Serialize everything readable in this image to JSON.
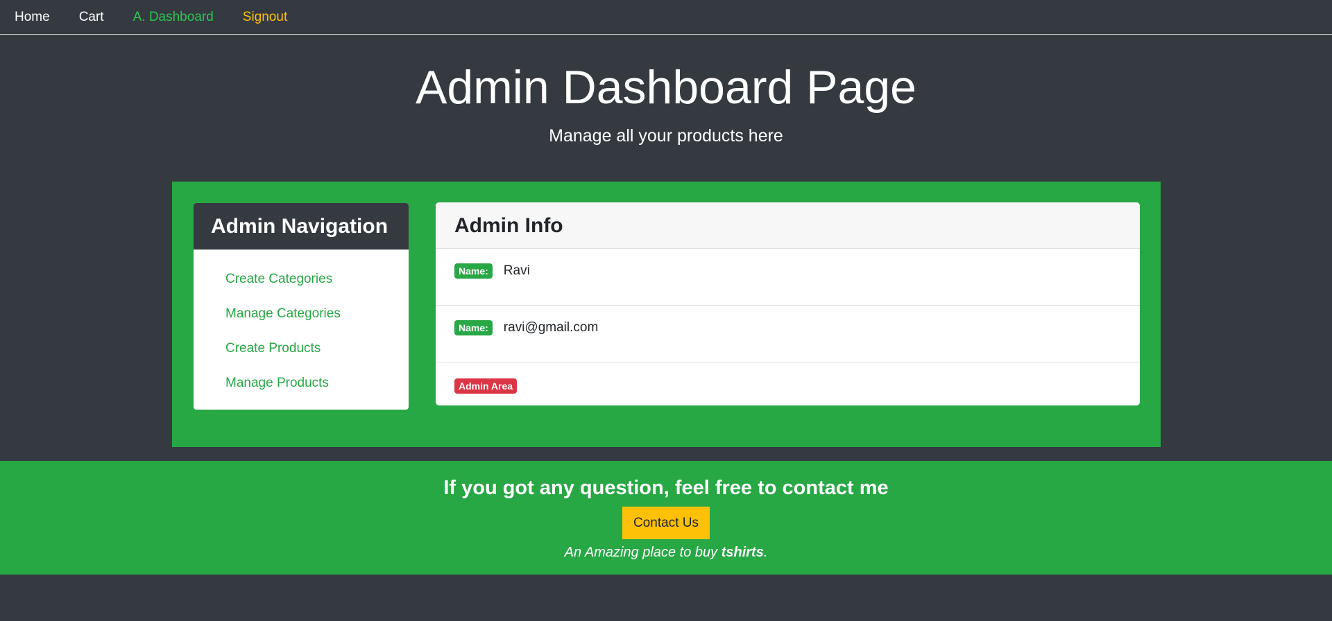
{
  "navbar": {
    "links": [
      {
        "label": "Home"
      },
      {
        "label": "Cart"
      },
      {
        "label": "A. Dashboard"
      },
      {
        "label": "Signout"
      }
    ]
  },
  "hero": {
    "title": "Admin Dashboard Page",
    "subtitle": "Manage all your products here"
  },
  "admin_nav": {
    "title": "Admin Navigation",
    "items": [
      {
        "label": "Create Categories"
      },
      {
        "label": "Manage Categories"
      },
      {
        "label": "Create Products"
      },
      {
        "label": "Manage Products"
      }
    ]
  },
  "admin_info": {
    "title": "Admin Info",
    "rows": [
      {
        "badge": "Name:",
        "value": "Ravi"
      },
      {
        "badge": "Name:",
        "value": "ravi@gmail.com"
      }
    ],
    "area_badge": "Admin Area"
  },
  "footer": {
    "heading": "If you got any question, feel free to contact me",
    "button_label": "Contact Us",
    "tagline_prefix": "An Amazing place to buy ",
    "tagline_bold": "tshirts",
    "tagline_suffix": "."
  },
  "colors": {
    "background": "#343a40",
    "accent_green": "#28a745",
    "active_link": "#2cc653",
    "warning": "#ffc107",
    "danger": "#dc3545"
  }
}
